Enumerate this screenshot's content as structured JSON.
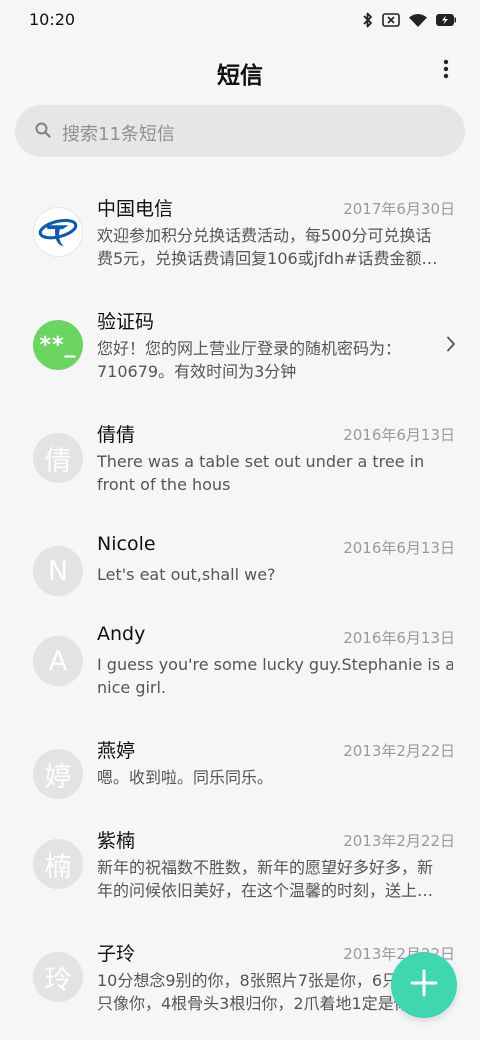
{
  "status_bar": {
    "time": "10:20"
  },
  "header": {
    "title": "短信"
  },
  "search": {
    "placeholder": "搜索11条短信"
  },
  "conversations": [
    {
      "name": "中国电信",
      "date": "2017年6月30日",
      "avatar": "china-telecom-logo",
      "preview_lines": [
        "欢迎参加积分兑换话费活动，每500分可兑换话",
        "费5元，兑换话费请回复106或jfdh#话费金额…"
      ]
    },
    {
      "name": "验证码",
      "date": "",
      "avatar_text": "**_",
      "preview_lines": [
        "您好！您的网上营业厅登录的随机密码为：",
        "710679。有效时间为3分钟"
      ]
    },
    {
      "name": "倩倩",
      "date": "2016年6月13日",
      "avatar_text": "倩",
      "preview_lines": [
        "There was a table set out under a tree in",
        "front of the hous"
      ]
    },
    {
      "name": "Nicole",
      "date": "2016年6月13日",
      "avatar_text": "N",
      "preview_lines": [
        "Let's eat out,shall we?"
      ]
    },
    {
      "name": "Andy",
      "date": "2016年6月13日",
      "avatar_text": "A",
      "preview_lines": [
        "I guess you're some lucky guy.Stephanie is a",
        "nice girl."
      ]
    },
    {
      "name": "燕婷",
      "date": "2013年2月22日",
      "avatar_text": "婷",
      "preview_lines": [
        "嗯。收到啦。同乐同乐。"
      ]
    },
    {
      "name": "紫楠",
      "date": "2013年2月22日",
      "avatar_text": "楠",
      "preview_lines": [
        "新年的祝福数不胜数，新年的愿望好多好多，新",
        "年的问候依旧美好，在这个温馨的时刻，送上…"
      ]
    },
    {
      "name": "子玲",
      "date": "2013年2月22日",
      "avatar_text": "玲",
      "preview_lines": [
        "10分想念9别的你，8张照片7张是你，6只",
        "只像你，4根骨头3根归你，2爪着地1定是你"
      ]
    }
  ],
  "icons": {
    "search": "search-icon",
    "more": "more-vertical-icon",
    "chevron": "chevron-right-icon",
    "fab": "plus-icon"
  },
  "colors": {
    "accent": "#3fd6b0",
    "code_avatar": "#6cd562",
    "telecom_blue": "#0e5ba8"
  }
}
